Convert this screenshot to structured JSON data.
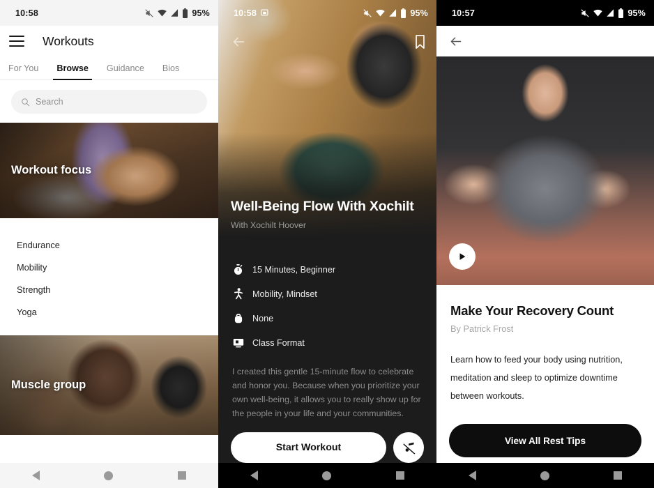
{
  "accents": {
    "dark_bg": "#1c1c1c",
    "light_bg": "#ffffff",
    "muted_text": "#8b8b8b",
    "cta_dark": "#0d0d0d",
    "nav_icon": "#9a9a9a"
  },
  "phone1": {
    "statusbar": {
      "time": "10:58",
      "battery": "95%",
      "icons": [
        "mute-icon",
        "wifi-icon",
        "cellular-icon",
        "battery-icon"
      ]
    },
    "appbar": {
      "menu_icon": "hamburger-menu-icon",
      "title": "Workouts"
    },
    "tabs": [
      {
        "label": "For You",
        "active": false
      },
      {
        "label": "Browse",
        "active": true
      },
      {
        "label": "Guidance",
        "active": false
      },
      {
        "label": "Bios",
        "active": false
      }
    ],
    "search": {
      "placeholder": "Search",
      "icon": "search-icon"
    },
    "hero_cards": [
      {
        "label": "Workout focus"
      },
      {
        "label": "Muscle group"
      }
    ],
    "focus_items": [
      "Endurance",
      "Mobility",
      "Strength",
      "Yoga"
    ],
    "navbar": {
      "back": "back-triangle-icon",
      "home": "home-circle-icon",
      "recent": "recent-square-icon"
    }
  },
  "phone2": {
    "statusbar": {
      "time": "10:58",
      "battery": "95%",
      "icons": [
        "cast-icon",
        "mute-icon",
        "wifi-icon",
        "cellular-icon",
        "battery-icon"
      ]
    },
    "topbar": {
      "back_icon": "back-arrow-icon",
      "bookmark_icon": "bookmark-icon"
    },
    "title": "Well-Being Flow With Xochilt",
    "subtitle": "With Xochilt Hoover",
    "meta": [
      {
        "icon": "stopwatch-icon",
        "text": "15 Minutes, Beginner"
      },
      {
        "icon": "running-person-icon",
        "text": "Mobility, Mindset"
      },
      {
        "icon": "kettlebell-icon",
        "text": "None"
      },
      {
        "icon": "screen-icon",
        "text": "Class Format"
      }
    ],
    "description": "I created this gentle 15-minute flow to celebrate and honor you. Because when you prioritize your own well-being, it allows you to really show up for the people in your life and your communities.",
    "primary_button": "Start Workout",
    "music_button_icon": "music-off-icon",
    "navbar": {
      "back": "back-triangle-icon",
      "home": "home-circle-icon",
      "recent": "recent-square-icon"
    }
  },
  "phone3": {
    "statusbar": {
      "time": "10:57",
      "battery": "95%",
      "icons": [
        "mute-icon",
        "wifi-icon",
        "cellular-icon",
        "battery-icon"
      ]
    },
    "topbar": {
      "back_icon": "back-arrow-icon"
    },
    "player": {
      "play_icon": "play-icon"
    },
    "title": "Make Your Recovery Count",
    "author": "By Patrick Frost",
    "description": "Learn how to feed your body using nutrition, meditation and sleep to optimize downtime between workouts.",
    "primary_button": "View All Rest Tips",
    "navbar": {
      "back": "back-triangle-icon",
      "home": "home-circle-icon",
      "recent": "recent-square-icon"
    }
  }
}
